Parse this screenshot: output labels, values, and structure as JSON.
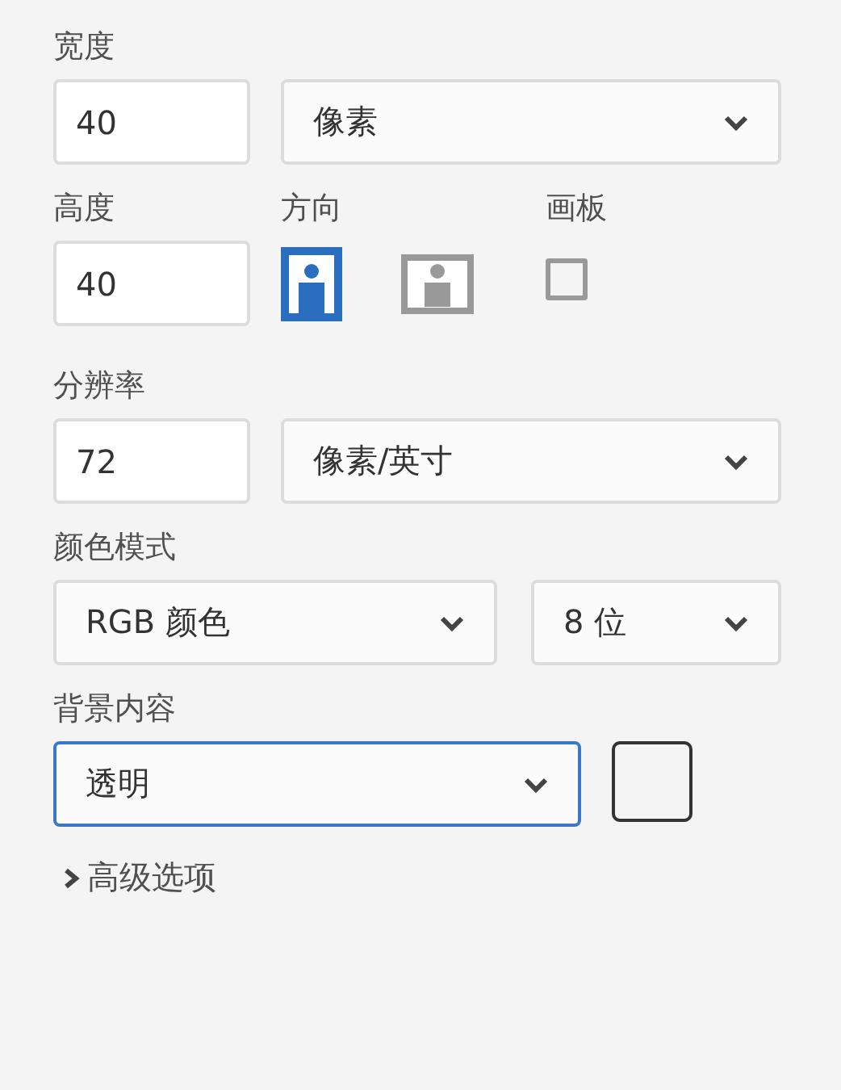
{
  "width": {
    "label": "宽度",
    "value": "40",
    "unit": "像素"
  },
  "height": {
    "label": "高度",
    "value": "40"
  },
  "orientation": {
    "label": "方向",
    "options": [
      {
        "kind": "portrait",
        "selected": true
      },
      {
        "kind": "landscape",
        "selected": false
      }
    ]
  },
  "artboard": {
    "label": "画板",
    "checked": false
  },
  "resolution": {
    "label": "分辨率",
    "value": "72",
    "unit": "像素/英寸"
  },
  "color_mode": {
    "label": "颜色模式",
    "mode": "RGB 颜色",
    "depth": "8 位"
  },
  "background": {
    "label": "背景内容",
    "value": "透明",
    "focused": true
  },
  "advanced": {
    "label": "高级选项",
    "expanded": false
  }
}
